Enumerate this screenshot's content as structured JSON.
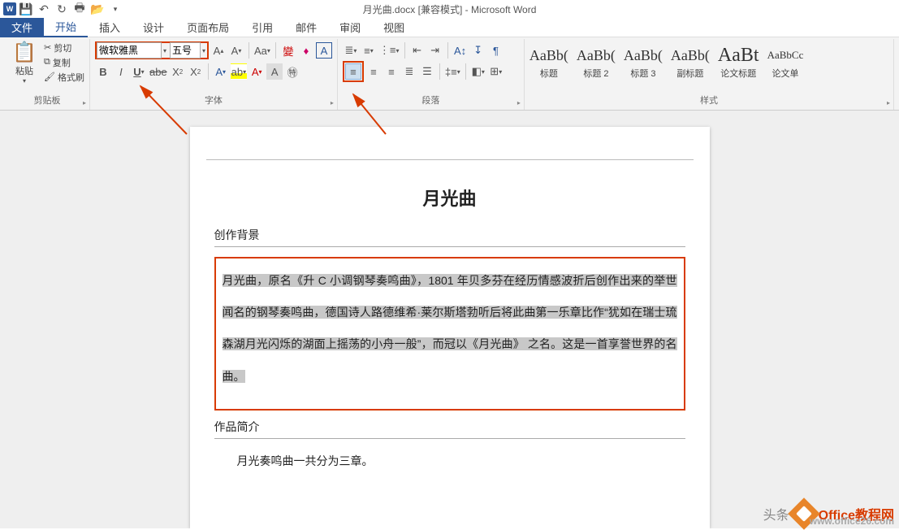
{
  "title": "月光曲.docx [兼容模式] - Microsoft Word",
  "tabs": {
    "file": "文件",
    "home": "开始",
    "insert": "插入",
    "design": "设计",
    "layout": "页面布局",
    "ref": "引用",
    "mail": "邮件",
    "review": "审阅",
    "view": "视图"
  },
  "clipboard": {
    "paste": "粘贴",
    "cut": "剪切",
    "copy": "复制",
    "painter": "格式刷",
    "group": "剪贴板"
  },
  "font": {
    "name": "微软雅黑",
    "size": "五号",
    "group": "字体"
  },
  "para": {
    "group": "段落"
  },
  "styles": {
    "items": [
      {
        "preview": "AaBb(",
        "label": "标题"
      },
      {
        "preview": "AaBb(",
        "label": "标题 2"
      },
      {
        "preview": "AaBb(",
        "label": "标题 3"
      },
      {
        "preview": "AaBb(",
        "label": "副标题"
      },
      {
        "preview": "AaBt",
        "label": "论文标题"
      },
      {
        "preview": "AaBbCc",
        "label": "论文单"
      }
    ],
    "group": "样式"
  },
  "doc": {
    "title": "月光曲",
    "sect1": "创作背景",
    "para1": "月光曲，原名《升 C 小调钢琴奏鸣曲》，1801 年贝多芬在经历情感波折后创作出来的举世闻名的钢琴奏鸣曲，德国诗人路德维希·莱尔斯塔勃听后将此曲第一乐章比作“犹如在瑞士琉森湖月光闪烁的湖面上摇荡的小舟一般”，而冠以《月光曲》 之名。这是一首享誉世界的名曲。",
    "sect2": "作品简介",
    "para2": "月光奏鸣曲一共分为三章。"
  },
  "watermark": {
    "brand": "Office教程网",
    "url": "www.office26.com",
    "prefix": "头条"
  }
}
